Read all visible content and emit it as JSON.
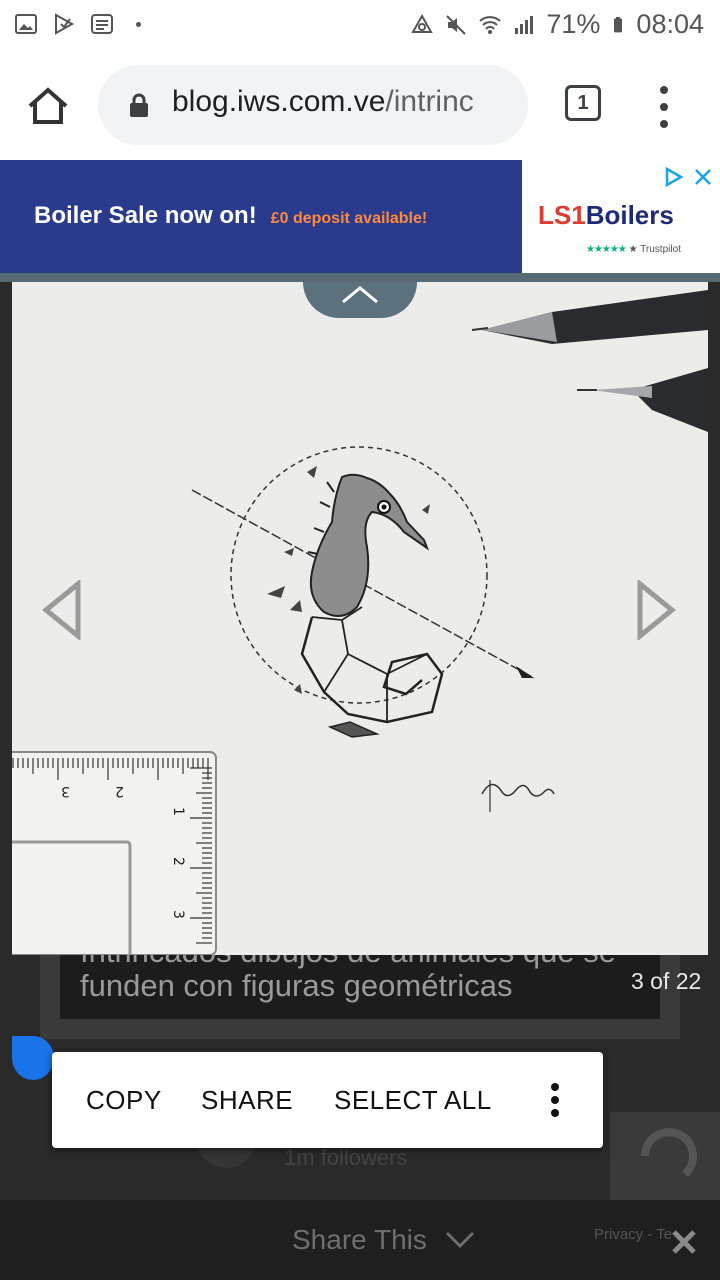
{
  "status_bar": {
    "battery": "71%",
    "time": "08:04"
  },
  "browser": {
    "url_host": "blog.iws.com.ve",
    "url_path": "/intrinc",
    "tab_count": "1"
  },
  "ad": {
    "headline": "Boiler Sale now on!",
    "promo": "£0 deposit available!",
    "brand_prefix": "LS1",
    "brand_suffix": "Boilers",
    "trust_stars": "★★★★★",
    "trust_label": "★ Trustpilot"
  },
  "gallery": {
    "caption": "Intrincados dibujos de animales que se funden con figuras geométricas",
    "counter": "3 of 22",
    "ruler_labels": [
      "3",
      "2",
      "1",
      "2",
      "3"
    ],
    "signature": "Kerby Rosanes 2014"
  },
  "context_menu": {
    "copy": "COPY",
    "share": "SHARE",
    "select_all": "SELECT ALL"
  },
  "background": {
    "followers": "1m followers"
  },
  "share_bar": {
    "label": "Share This",
    "privacy": "Privacy - Te"
  },
  "colors": {
    "ad_bg": "#2a3a8c",
    "selection": "#1a73e8",
    "collapse_btn": "#5b717e"
  }
}
